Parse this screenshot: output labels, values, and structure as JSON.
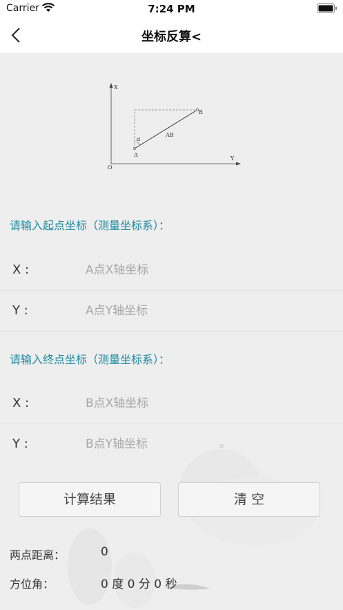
{
  "status_bar": {
    "carrier": "Carrier",
    "time": "7:24 PM"
  },
  "nav": {
    "title": "坐标反算<"
  },
  "diagram": {
    "axis_x": "X",
    "axis_y": "Y",
    "origin": "O",
    "point_a": "A",
    "point_b": "B",
    "segment": "AB",
    "angle": "α"
  },
  "start_section": {
    "title": "请输入起点坐标（测量坐标系）：",
    "x_label": "X :",
    "x_placeholder": "A点X轴坐标",
    "y_label": "Y :",
    "y_placeholder": "A点Y轴坐标"
  },
  "end_section": {
    "title": "请输入终点坐标（测量坐标系）：",
    "x_label": "X :",
    "x_placeholder": "B点X轴坐标",
    "y_label": "Y :",
    "y_placeholder": "B点Y轴坐标"
  },
  "buttons": {
    "calculate": "计算结果",
    "clear": "清 空"
  },
  "results": {
    "distance_label": "两点距离：",
    "distance_value": "0",
    "azimuth_label": "方位角：",
    "azimuth_value": "0 度 0 分 0 秒"
  }
}
